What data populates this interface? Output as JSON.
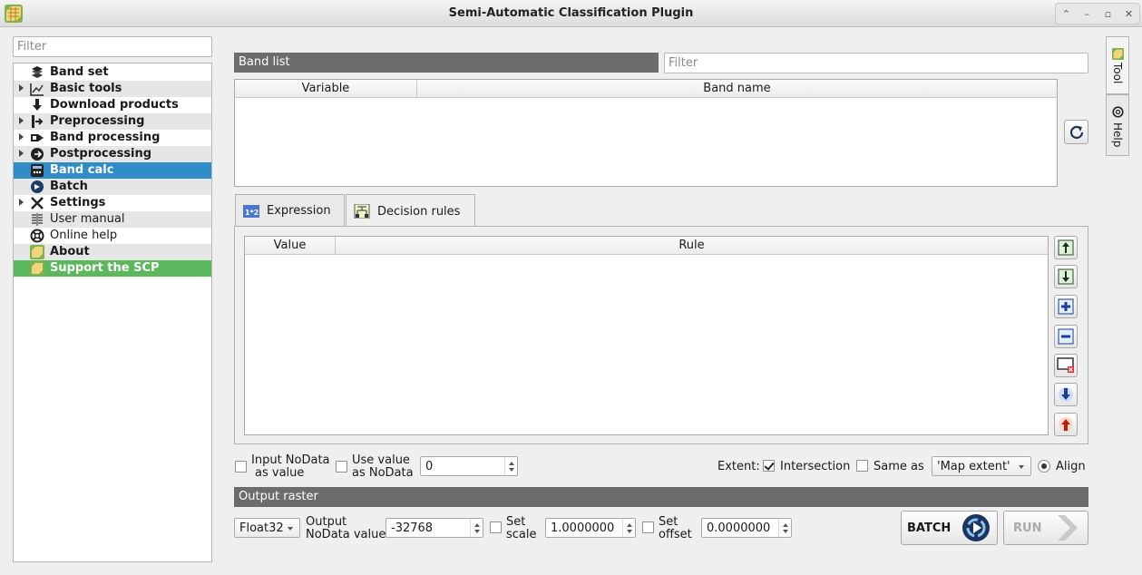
{
  "window": {
    "title": "Semi-Automatic Classification Plugin"
  },
  "sidebar": {
    "filter_placeholder": "Filter",
    "items": [
      {
        "label": "Band set",
        "icon": "band-set-icon"
      },
      {
        "label": "Basic tools",
        "icon": "basic-tools-icon"
      },
      {
        "label": "Download products",
        "icon": "download-icon"
      },
      {
        "label": "Preprocessing",
        "icon": "preprocessing-icon"
      },
      {
        "label": "Band processing",
        "icon": "band-processing-icon"
      },
      {
        "label": "Postprocessing",
        "icon": "postprocessing-icon"
      },
      {
        "label": "Band calc",
        "icon": "band-calc-icon"
      },
      {
        "label": "Batch",
        "icon": "batch-icon"
      },
      {
        "label": "Settings",
        "icon": "settings-icon"
      },
      {
        "label": "User manual",
        "icon": "manual-icon"
      },
      {
        "label": "Online help",
        "icon": "help-lifebuoy-icon"
      },
      {
        "label": "About",
        "icon": "scp-logo-icon"
      },
      {
        "label": "Support the SCP",
        "icon": "scp-logo-icon"
      }
    ]
  },
  "band_list": {
    "header": "Band list",
    "filter_placeholder": "Filter",
    "columns": [
      "Variable",
      "Band name"
    ]
  },
  "tabs": [
    {
      "label": "Expression",
      "icon": "expression-icon"
    },
    {
      "label": "Decision rules",
      "icon": "decision-rules-icon"
    }
  ],
  "rules_table": {
    "columns": [
      "Value",
      "Rule"
    ]
  },
  "options": {
    "input_nodata_line1": "Input NoData",
    "input_nodata_line2": "as value",
    "use_value_line1": "Use value",
    "use_value_line2": "as NoData",
    "nodata_value": "0",
    "extent_label": "Extent:",
    "intersection_label": "Intersection",
    "same_as_label": "Same as",
    "extent_combo": "'Map extent'",
    "align_label": "Align"
  },
  "output_raster": {
    "header": "Output raster",
    "data_type": "Float32",
    "output_nodata_line1": "Output",
    "output_nodata_line2": "NoData value",
    "output_nodata_value": "-32768",
    "set_scale_line1": "Set",
    "set_scale_line2": "scale",
    "scale_value": "1.0000000",
    "set_offset_line1": "Set",
    "set_offset_line2": "offset",
    "offset_value": "0.0000000",
    "batch_label": "BATCH",
    "run_label": "RUN"
  },
  "side_tabs": {
    "tool": "Tool",
    "help": "Help"
  },
  "colors": {
    "selected": "#308cc6",
    "support": "#5cb85c",
    "section_header": "#6c6c6c"
  }
}
